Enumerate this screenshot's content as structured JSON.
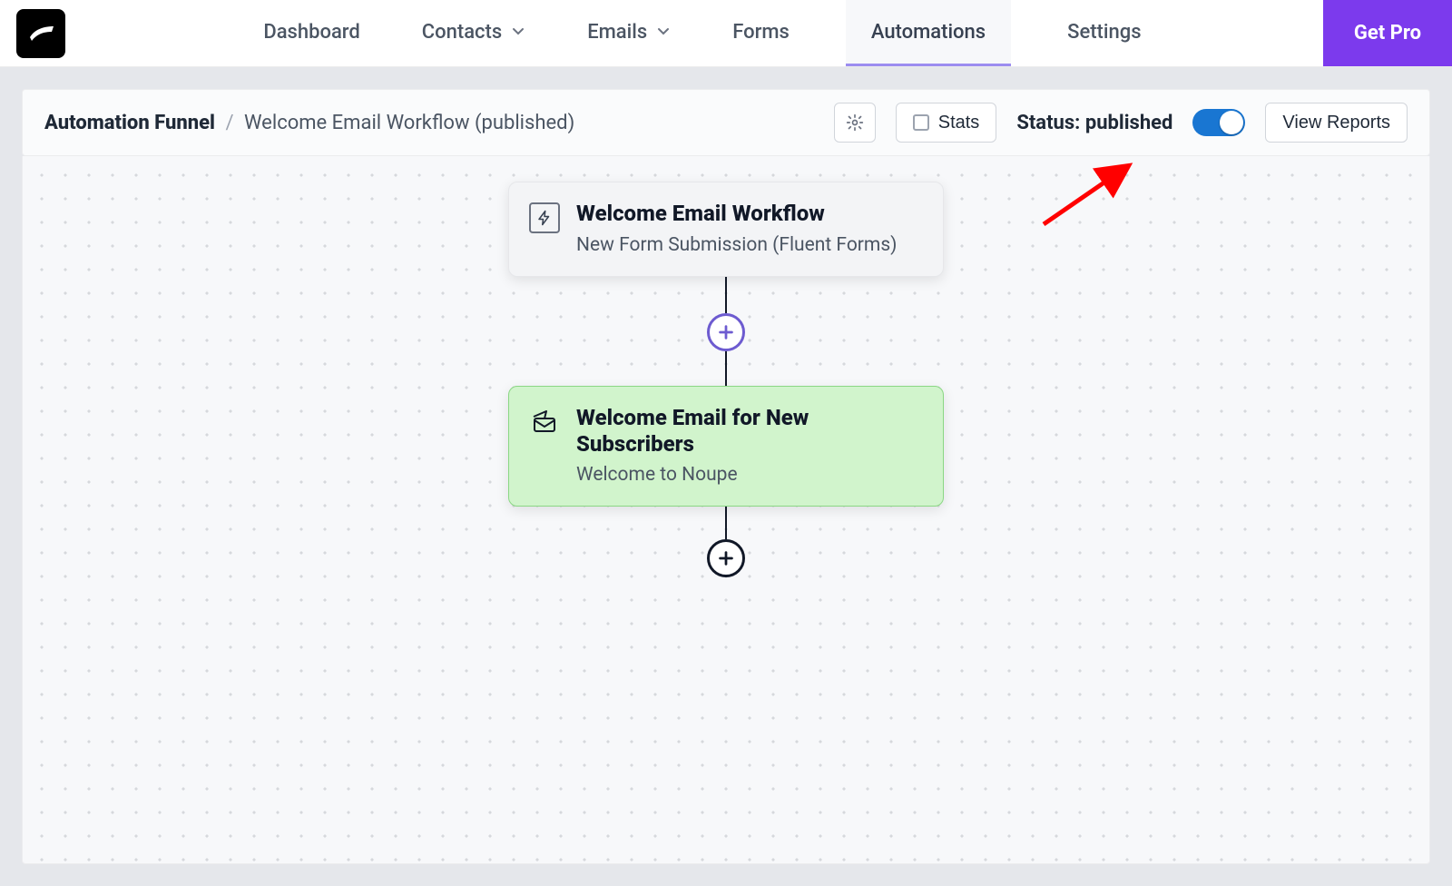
{
  "nav": {
    "items": [
      {
        "label": "Dashboard",
        "dropdown": false,
        "active": false
      },
      {
        "label": "Contacts",
        "dropdown": true,
        "active": false
      },
      {
        "label": "Emails",
        "dropdown": true,
        "active": false
      },
      {
        "label": "Forms",
        "dropdown": false,
        "active": false
      },
      {
        "label": "Automations",
        "dropdown": false,
        "active": true
      },
      {
        "label": "Settings",
        "dropdown": false,
        "active": false
      }
    ],
    "cta": "Get Pro"
  },
  "toolbar": {
    "breadcrumb": {
      "root": "Automation Funnel",
      "separator": "/",
      "current": "Welcome Email Workflow (published)"
    },
    "settings_tooltip": "Settings",
    "stats_label": "Stats",
    "status_prefix": "Status:",
    "status_value": "published",
    "status_on": true,
    "view_reports": "View Reports"
  },
  "workflow": {
    "nodes": [
      {
        "kind": "trigger",
        "icon": "bolt-icon",
        "title": "Welcome Email Workflow",
        "subtitle": "New Form Submission (Fluent Forms)"
      },
      {
        "kind": "action",
        "icon": "send-mail-icon",
        "title": "Welcome Email for New Subscribers",
        "subtitle": "Welcome to Noupe"
      }
    ],
    "add_step_label": "Add step"
  },
  "colors": {
    "primary": "#7c3aed",
    "toggle_on": "#1976d2",
    "action_bg": "#d1f4cc",
    "annotation_arrow": "#ff0000"
  }
}
